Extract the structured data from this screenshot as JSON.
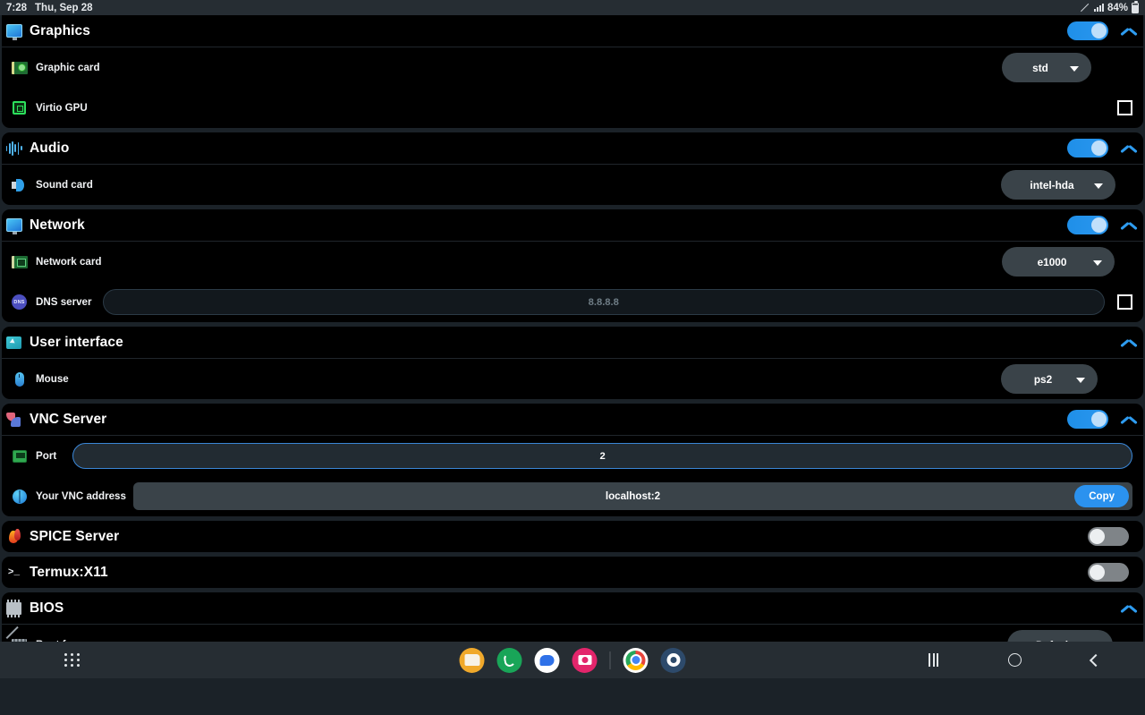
{
  "statusbar": {
    "time": "7:28",
    "date": "Thu, Sep 28",
    "battery": "84%",
    "pencil_icon": "pencil-icon",
    "signal_icon": "signal-icon",
    "battery_icon": "battery-icon"
  },
  "sections": {
    "graphics": {
      "title": "Graphics",
      "icon": "monitor-icon",
      "toggle": "on",
      "chevron": "chevron-up",
      "rows": {
        "graphic_card": {
          "label": "Graphic card",
          "icon": "graphics-card-icon",
          "value": "std"
        },
        "virtio_gpu": {
          "label": "Virtio GPU",
          "icon": "chip-icon",
          "checked": false
        }
      }
    },
    "audio": {
      "title": "Audio",
      "icon": "waveform-icon",
      "toggle": "on",
      "chevron": "chevron-up",
      "rows": {
        "sound_card": {
          "label": "Sound card",
          "icon": "speaker-icon",
          "value": "intel-hda"
        }
      }
    },
    "network": {
      "title": "Network",
      "icon": "monitor-icon",
      "toggle": "on",
      "chevron": "chevron-up",
      "rows": {
        "network_card": {
          "label": "Network card",
          "icon": "network-card-icon",
          "value": "e1000"
        },
        "dns_server": {
          "label": "DNS server",
          "icon": "dns-icon",
          "value": "",
          "placeholder": "8.8.8.8",
          "checked": false
        }
      }
    },
    "user_interface": {
      "title": "User interface",
      "icon": "cursor-icon",
      "chevron": "chevron-up",
      "rows": {
        "mouse": {
          "label": "Mouse",
          "icon": "mouse-icon",
          "value": "ps2"
        }
      }
    },
    "vnc_server": {
      "title": "VNC Server",
      "icon": "vnc-icon",
      "toggle": "on",
      "chevron": "chevron-up",
      "rows": {
        "port": {
          "label": "Port",
          "icon": "ethernet-port-icon",
          "value": "2"
        },
        "vnc_address": {
          "label": "Your VNC address",
          "icon": "globe-icon",
          "value": "localhost:2",
          "copy_label": "Copy"
        }
      }
    },
    "spice_server": {
      "title": "SPICE Server",
      "icon": "flame-icon",
      "toggle": "off"
    },
    "termux_x11": {
      "title": "Termux:X11",
      "icon": "terminal-icon",
      "toggle": "off"
    },
    "bios": {
      "title": "BIOS",
      "icon": "bios-chip-icon",
      "chevron": "chevron-up",
      "rows": {
        "boot_from": {
          "label": "Boot from",
          "icon": "memory-icon",
          "value": "Default"
        }
      }
    }
  },
  "navbar": {
    "apps_button": "apps-grid-icon",
    "dock": [
      {
        "name": "files-app-icon"
      },
      {
        "name": "phone-app-icon"
      },
      {
        "name": "messages-app-icon"
      },
      {
        "name": "camera-app-icon"
      },
      {
        "name": "dock-separator"
      },
      {
        "name": "chrome-app-icon"
      },
      {
        "name": "settings-app-icon"
      }
    ],
    "recent_icon": "recent-apps-icon",
    "home_icon": "home-icon",
    "back_icon": "back-icon"
  },
  "colors": {
    "accent_blue": "#2b92ef",
    "card_bg": "#000000",
    "page_bg": "#1b2228",
    "bar_bg": "#262d33"
  }
}
